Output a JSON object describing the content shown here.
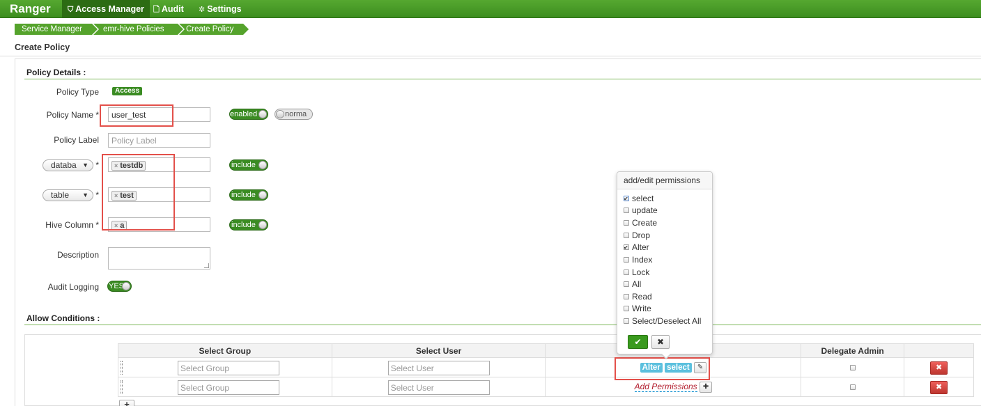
{
  "nav": {
    "brand": "Ranger",
    "items": [
      {
        "label": "Access Manager",
        "icon": "shield-icon",
        "icon_glyph": "⛉"
      },
      {
        "label": "Audit",
        "icon": "file-icon",
        "icon_glyph": "🗋"
      },
      {
        "label": "Settings",
        "icon": "gear-icon",
        "icon_glyph": "✲"
      }
    ]
  },
  "breadcrumb": [
    "Service Manager",
    "emr-hive Policies",
    "Create Policy"
  ],
  "page_title": "Create Policy",
  "policy_details": {
    "title": "Policy Details :",
    "policy_type_label": "Policy Type",
    "policy_type_value": "Access",
    "policy_name_label": "Policy Name *",
    "policy_name_value": "user_test",
    "enabled_toggle": "enabled",
    "normal_toggle": "norma",
    "policy_label_label": "Policy Label",
    "policy_label_placeholder": "Policy Label",
    "database_select": "databa",
    "database_tag": "testdb",
    "database_include": "include",
    "table_select": "table",
    "table_tag": "test",
    "table_include": "include",
    "column_label": "Hive Column *",
    "column_tag": "a",
    "column_include": "include",
    "description_label": "Description",
    "audit_label": "Audit Logging",
    "audit_toggle": "YES",
    "asterisk": "*",
    "tag_remove": "×"
  },
  "allow_conditions": {
    "title": "Allow Conditions :",
    "headers": [
      "Select Group",
      "Select User",
      "",
      "Delegate Admin",
      ""
    ],
    "rows": [
      {
        "group_placeholder": "Select Group",
        "user_placeholder": "Select User",
        "permissions": [
          "Alter",
          "select"
        ]
      },
      {
        "group_placeholder": "Select Group",
        "user_placeholder": "Select User",
        "add_permissions": "Add Permissions"
      }
    ]
  },
  "popover": {
    "title": "add/edit permissions",
    "options": [
      {
        "label": "select",
        "checked": true
      },
      {
        "label": "update",
        "checked": false
      },
      {
        "label": "Create",
        "checked": false
      },
      {
        "label": "Drop",
        "checked": false
      },
      {
        "label": "Alter",
        "checked": true
      },
      {
        "label": "Index",
        "checked": false
      },
      {
        "label": "Lock",
        "checked": false
      },
      {
        "label": "All",
        "checked": false
      },
      {
        "label": "Read",
        "checked": false
      },
      {
        "label": "Write",
        "checked": false
      },
      {
        "label": "Select/Deselect All",
        "checked": false
      }
    ],
    "ok_glyph": "✔",
    "cancel_glyph": "✖"
  },
  "colors": {
    "nav_green": "#3d8d1f",
    "accent_green": "#3a8b22",
    "highlight_red": "#e3504a",
    "perm_blue": "#5bc0de"
  }
}
